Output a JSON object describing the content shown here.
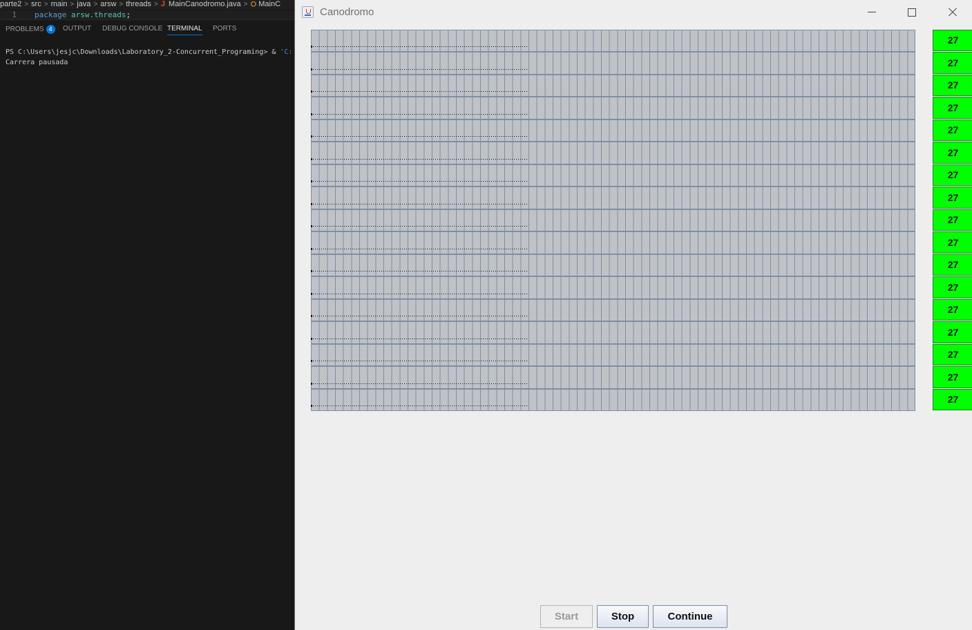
{
  "vscode": {
    "breadcrumb": [
      "parte2",
      "src",
      "main",
      "java",
      "arsw",
      "threads",
      "MainCanodromo.java",
      "MainC"
    ],
    "code": {
      "line_number": "1",
      "keyword": "package",
      "package_name": "arsw.threads",
      "punct": ";"
    },
    "panel_tabs": [
      "PROBLEMS",
      "OUTPUT",
      "DEBUG CONSOLE",
      "TERMINAL",
      "PORTS"
    ],
    "problems_count": "4",
    "active_tab": "TERMINAL",
    "terminal": {
      "prompt": "PS C:\\Users\\jesjc\\Downloads\\Laboratory_2-Concurrent_Programing>",
      "amp": "&",
      "cmd_fragment": "'C:",
      "output": "Carrera pausada"
    }
  },
  "window": {
    "title": "Canodromo",
    "lanes": 17,
    "cells_per_lane": 75,
    "progress_marks_per_lane": 27,
    "counters": [
      "27",
      "27",
      "27",
      "27",
      "27",
      "27",
      "27",
      "27",
      "27",
      "27",
      "27",
      "27",
      "27",
      "27",
      "27",
      "27",
      "27"
    ],
    "buttons": {
      "start": {
        "label": "Start",
        "enabled": false
      },
      "stop": {
        "label": "Stop",
        "enabled": true
      },
      "continue": {
        "label": "Continue",
        "enabled": true
      }
    },
    "colors": {
      "counter_bg": "#00ff00",
      "cell_fill": "#bfc3c8",
      "cell_border": "#7f8ea0",
      "window_bg": "#eeeeee"
    }
  }
}
